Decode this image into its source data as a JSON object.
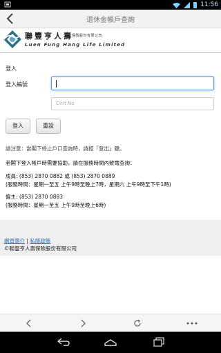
{
  "status_bar": {
    "time": "11:56",
    "accent_color": "#7fd0ff"
  },
  "app_bar": {
    "title": "退休金帳戶查詢"
  },
  "logo": {
    "chinese_name": "聯豐亨人壽",
    "chinese_small": "保險股份有限公司",
    "english_name": "Luen Fung Hang Life Limited"
  },
  "form": {
    "section_title": "登入",
    "login_label": "登入編號",
    "login_value": "",
    "cert_placeholder": "Cert No",
    "login_button": "登入",
    "reset_button": "重設"
  },
  "notes": {
    "logout_note": "請注意：當閣下終止戶口查詢時，請按「登出」鍵。",
    "help_intro": "若閣下登入帳戶時需要協助，請在服務時間內致電查詢：",
    "members_line1": "成員: (853) 2870 0882 或 (853) 2870 0889",
    "members_line2": "(服務時間：星期一至五 上午9時至晚上7時，星期六 上午9時至下午1時)",
    "employer_line1": "僱主: (853) 2870 0883",
    "employer_line2": "(服務時間：星期一至五 上午9時至晚上6時)"
  },
  "footer": {
    "link_about": "網頁簡介",
    "separator": "|",
    "link_privacy": "私隱政策",
    "copyright": "©聯豐亨人壽保險股份有限公司"
  },
  "browser_bar": {
    "icons": [
      "back-arrow-icon",
      "forward-arrow-icon",
      "refresh-icon",
      "more-icon"
    ]
  },
  "nav_bar": {
    "icons": [
      "back-icon",
      "home-icon",
      "recents-icon"
    ]
  }
}
